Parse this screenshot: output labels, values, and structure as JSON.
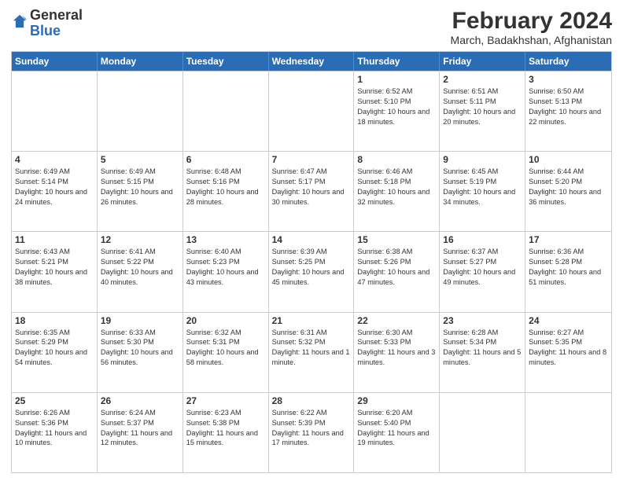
{
  "header": {
    "logo_general": "General",
    "logo_blue": "Blue",
    "month_year": "February 2024",
    "location": "March, Badakhshan, Afghanistan"
  },
  "weekdays": [
    "Sunday",
    "Monday",
    "Tuesday",
    "Wednesday",
    "Thursday",
    "Friday",
    "Saturday"
  ],
  "rows": [
    [
      {
        "day": "",
        "info": ""
      },
      {
        "day": "",
        "info": ""
      },
      {
        "day": "",
        "info": ""
      },
      {
        "day": "",
        "info": ""
      },
      {
        "day": "1",
        "info": "Sunrise: 6:52 AM\nSunset: 5:10 PM\nDaylight: 10 hours and 18 minutes."
      },
      {
        "day": "2",
        "info": "Sunrise: 6:51 AM\nSunset: 5:11 PM\nDaylight: 10 hours and 20 minutes."
      },
      {
        "day": "3",
        "info": "Sunrise: 6:50 AM\nSunset: 5:13 PM\nDaylight: 10 hours and 22 minutes."
      }
    ],
    [
      {
        "day": "4",
        "info": "Sunrise: 6:49 AM\nSunset: 5:14 PM\nDaylight: 10 hours and 24 minutes."
      },
      {
        "day": "5",
        "info": "Sunrise: 6:49 AM\nSunset: 5:15 PM\nDaylight: 10 hours and 26 minutes."
      },
      {
        "day": "6",
        "info": "Sunrise: 6:48 AM\nSunset: 5:16 PM\nDaylight: 10 hours and 28 minutes."
      },
      {
        "day": "7",
        "info": "Sunrise: 6:47 AM\nSunset: 5:17 PM\nDaylight: 10 hours and 30 minutes."
      },
      {
        "day": "8",
        "info": "Sunrise: 6:46 AM\nSunset: 5:18 PM\nDaylight: 10 hours and 32 minutes."
      },
      {
        "day": "9",
        "info": "Sunrise: 6:45 AM\nSunset: 5:19 PM\nDaylight: 10 hours and 34 minutes."
      },
      {
        "day": "10",
        "info": "Sunrise: 6:44 AM\nSunset: 5:20 PM\nDaylight: 10 hours and 36 minutes."
      }
    ],
    [
      {
        "day": "11",
        "info": "Sunrise: 6:43 AM\nSunset: 5:21 PM\nDaylight: 10 hours and 38 minutes."
      },
      {
        "day": "12",
        "info": "Sunrise: 6:41 AM\nSunset: 5:22 PM\nDaylight: 10 hours and 40 minutes."
      },
      {
        "day": "13",
        "info": "Sunrise: 6:40 AM\nSunset: 5:23 PM\nDaylight: 10 hours and 43 minutes."
      },
      {
        "day": "14",
        "info": "Sunrise: 6:39 AM\nSunset: 5:25 PM\nDaylight: 10 hours and 45 minutes."
      },
      {
        "day": "15",
        "info": "Sunrise: 6:38 AM\nSunset: 5:26 PM\nDaylight: 10 hours and 47 minutes."
      },
      {
        "day": "16",
        "info": "Sunrise: 6:37 AM\nSunset: 5:27 PM\nDaylight: 10 hours and 49 minutes."
      },
      {
        "day": "17",
        "info": "Sunrise: 6:36 AM\nSunset: 5:28 PM\nDaylight: 10 hours and 51 minutes."
      }
    ],
    [
      {
        "day": "18",
        "info": "Sunrise: 6:35 AM\nSunset: 5:29 PM\nDaylight: 10 hours and 54 minutes."
      },
      {
        "day": "19",
        "info": "Sunrise: 6:33 AM\nSunset: 5:30 PM\nDaylight: 10 hours and 56 minutes."
      },
      {
        "day": "20",
        "info": "Sunrise: 6:32 AM\nSunset: 5:31 PM\nDaylight: 10 hours and 58 minutes."
      },
      {
        "day": "21",
        "info": "Sunrise: 6:31 AM\nSunset: 5:32 PM\nDaylight: 11 hours and 1 minute."
      },
      {
        "day": "22",
        "info": "Sunrise: 6:30 AM\nSunset: 5:33 PM\nDaylight: 11 hours and 3 minutes."
      },
      {
        "day": "23",
        "info": "Sunrise: 6:28 AM\nSunset: 5:34 PM\nDaylight: 11 hours and 5 minutes."
      },
      {
        "day": "24",
        "info": "Sunrise: 6:27 AM\nSunset: 5:35 PM\nDaylight: 11 hours and 8 minutes."
      }
    ],
    [
      {
        "day": "25",
        "info": "Sunrise: 6:26 AM\nSunset: 5:36 PM\nDaylight: 11 hours and 10 minutes."
      },
      {
        "day": "26",
        "info": "Sunrise: 6:24 AM\nSunset: 5:37 PM\nDaylight: 11 hours and 12 minutes."
      },
      {
        "day": "27",
        "info": "Sunrise: 6:23 AM\nSunset: 5:38 PM\nDaylight: 11 hours and 15 minutes."
      },
      {
        "day": "28",
        "info": "Sunrise: 6:22 AM\nSunset: 5:39 PM\nDaylight: 11 hours and 17 minutes."
      },
      {
        "day": "29",
        "info": "Sunrise: 6:20 AM\nSunset: 5:40 PM\nDaylight: 11 hours and 19 minutes."
      },
      {
        "day": "",
        "info": ""
      },
      {
        "day": "",
        "info": ""
      }
    ]
  ]
}
